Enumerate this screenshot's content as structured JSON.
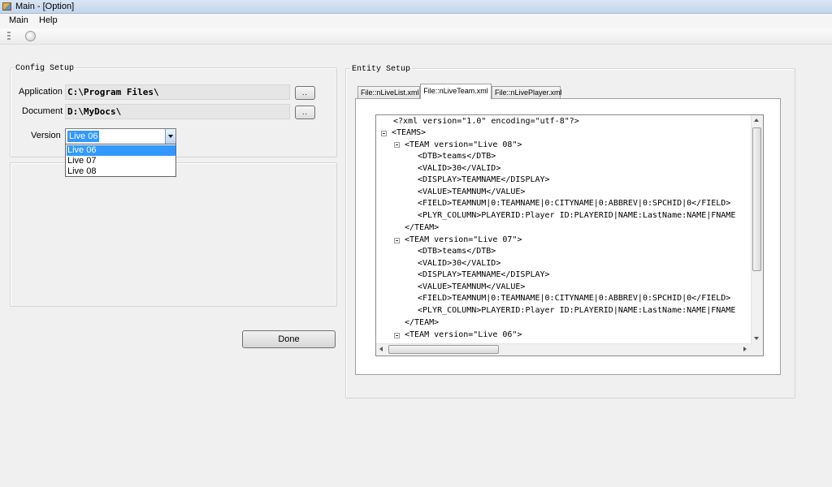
{
  "window": {
    "title": "Main - [Option]"
  },
  "menu": {
    "items": [
      {
        "label": "Main"
      },
      {
        "label": "Help"
      }
    ]
  },
  "config_setup": {
    "title": "Config Setup",
    "application_label": "Application",
    "application_value": "C:\\Program Files\\",
    "document_label": "Document",
    "document_value": "D:\\MyDocs\\",
    "browse_label": "..",
    "version_label": "Version",
    "version_selected": "Live 06",
    "version_options": [
      "Live 06",
      "Live 07",
      "Live 08"
    ]
  },
  "done_button": {
    "label": "Done"
  },
  "entity_setup": {
    "title": "Entity Setup",
    "tabs": [
      {
        "label": "File::nLiveList.xml"
      },
      {
        "label": "File::nLiveTeam.xml"
      },
      {
        "label": "File::nLivePlayer.xml"
      }
    ],
    "active_tab": "File::nLiveTeam.xml",
    "xml_lines": [
      {
        "text": "<?xml version=\"1.0\" encoding=\"utf-8\"?>"
      },
      {
        "text": "<TEAMS>"
      },
      {
        "text": "<TEAM version=\"Live 08\">"
      },
      {
        "text": "<DTB>teams</DTB>"
      },
      {
        "text": "<VALID>30</VALID>"
      },
      {
        "text": "<DISPLAY>TEAMNAME</DISPLAY>"
      },
      {
        "text": "<VALUE>TEAMNUM</VALUE>"
      },
      {
        "text": "<FIELD>TEAMNUM|0:TEAMNAME|0:CITYNAME|0:ABBREV|0:SPCHID|0</FIELD>"
      },
      {
        "text": "<PLYR_COLUMN>PLAYERID:Player ID:PLAYERID|NAME:LastName:NAME|FNAME"
      },
      {
        "text": "</TEAM>"
      },
      {
        "text": "<TEAM version=\"Live 07\">"
      },
      {
        "text": "<DTB>teams</DTB>"
      },
      {
        "text": "<VALID>30</VALID>"
      },
      {
        "text": "<DISPLAY>TEAMNAME</DISPLAY>"
      },
      {
        "text": "<VALUE>TEAMNUM</VALUE>"
      },
      {
        "text": "<FIELD>TEAMNUM|0:TEAMNAME|0:CITYNAME|0:ABBREV|0:SPCHID|0</FIELD>"
      },
      {
        "text": "<PLYR_COLUMN>PLAYERID:Player ID:PLAYERID|NAME:LastName:NAME|FNAME"
      },
      {
        "text": "</TEAM>"
      },
      {
        "text": "<TEAM version=\"Live 06\">"
      }
    ]
  }
}
